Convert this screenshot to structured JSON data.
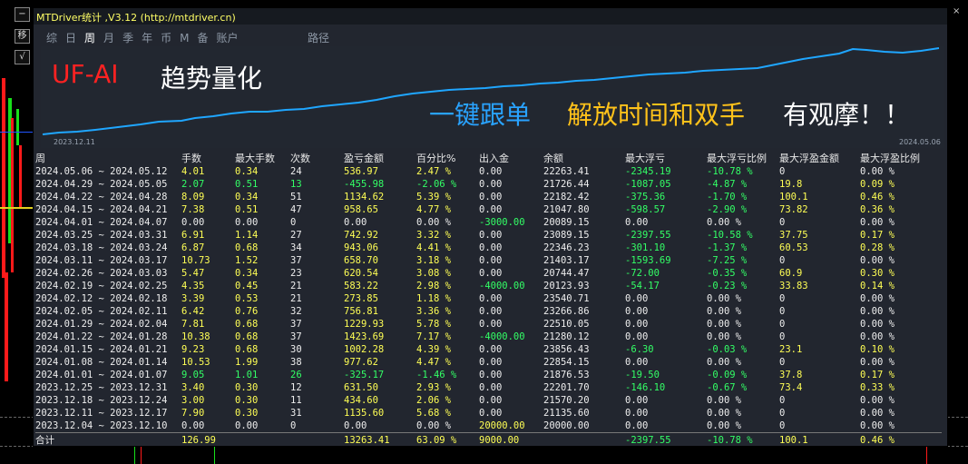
{
  "window": {
    "title": "MTDriver统计 ,V3.12 (http://mtdriver.cn)",
    "close_label": "×"
  },
  "side_buttons": [
    "−",
    "移",
    "√"
  ],
  "tabs": [
    "综",
    "日",
    "周",
    "月",
    "季",
    "年",
    "币",
    "M",
    "备",
    "账户"
  ],
  "active_tab": 2,
  "path_label": "路径",
  "banner": {
    "brand": "UF-AI",
    "slogan_1": "趋势量化",
    "slogan_2": "一键跟单",
    "slogan_3": "解放时间和双手",
    "slogan_4": "有观摩！！",
    "start_date": "2023.12.11",
    "end_date": "2024.05.06",
    "colors": {
      "brand": "#ff2222",
      "slogan_2": "#29a3ff",
      "slogan_3": "#ffc21a",
      "curve": "#1fa6ff"
    }
  },
  "table": {
    "headers": [
      "周",
      "手数",
      "最大手数",
      "次数",
      "盈亏金额",
      "百分比%",
      "出入金",
      "余额",
      "最大浮亏",
      "最大浮亏比例",
      "最大浮盈金额",
      "最大浮盈比例"
    ],
    "rows": [
      [
        "2024.05.06 ~ 2024.05.12",
        "4.01",
        "0.34",
        "24",
        "536.97",
        "2.47 %",
        "0.00",
        "22263.41",
        "-2345.19",
        "-10.78 %",
        "0",
        "0.00 %"
      ],
      [
        "2024.04.29 ~ 2024.05.05",
        "2.07",
        "0.51",
        "13",
        "-455.98",
        "-2.06 %",
        "0.00",
        "21726.44",
        "-1087.05",
        "-4.87 %",
        "19.8",
        "0.09 %"
      ],
      [
        "2024.04.22 ~ 2024.04.28",
        "8.09",
        "0.34",
        "51",
        "1134.62",
        "5.39 %",
        "0.00",
        "22182.42",
        "-375.36",
        "-1.70 %",
        "100.1",
        "0.46 %"
      ],
      [
        "2024.04.15 ~ 2024.04.21",
        "7.38",
        "0.51",
        "47",
        "958.65",
        "4.77 %",
        "0.00",
        "21047.80",
        "-598.57",
        "-2.90 %",
        "73.82",
        "0.36 %"
      ],
      [
        "2024.04.01 ~ 2024.04.07",
        "0.00",
        "0.00",
        "0",
        "0.00",
        "0.00 %",
        "-3000.00",
        "20089.15",
        "0.00",
        "0.00 %",
        "0",
        "0.00 %"
      ],
      [
        "2024.03.25 ~ 2024.03.31",
        "6.91",
        "1.14",
        "27",
        "742.92",
        "3.32 %",
        "0.00",
        "23089.15",
        "-2397.55",
        "-10.58 %",
        "37.75",
        "0.17 %"
      ],
      [
        "2024.03.18 ~ 2024.03.24",
        "6.87",
        "0.68",
        "34",
        "943.06",
        "4.41 %",
        "0.00",
        "22346.23",
        "-301.10",
        "-1.37 %",
        "60.53",
        "0.28 %"
      ],
      [
        "2024.03.11 ~ 2024.03.17",
        "10.73",
        "1.52",
        "37",
        "658.70",
        "3.18 %",
        "0.00",
        "21403.17",
        "-1593.69",
        "-7.25 %",
        "0",
        "0.00 %"
      ],
      [
        "2024.02.26 ~ 2024.03.03",
        "5.47",
        "0.34",
        "23",
        "620.54",
        "3.08 %",
        "0.00",
        "20744.47",
        "-72.00",
        "-0.35 %",
        "60.9",
        "0.30 %"
      ],
      [
        "2024.02.19 ~ 2024.02.25",
        "4.35",
        "0.45",
        "21",
        "583.22",
        "2.98 %",
        "-4000.00",
        "20123.93",
        "-54.17",
        "-0.23 %",
        "33.83",
        "0.14 %"
      ],
      [
        "2024.02.12 ~ 2024.02.18",
        "3.39",
        "0.53",
        "21",
        "273.85",
        "1.18 %",
        "0.00",
        "23540.71",
        "0.00",
        "0.00 %",
        "0",
        "0.00 %"
      ],
      [
        "2024.02.05 ~ 2024.02.11",
        "6.42",
        "0.76",
        "32",
        "756.81",
        "3.36 %",
        "0.00",
        "23266.86",
        "0.00",
        "0.00 %",
        "0",
        "0.00 %"
      ],
      [
        "2024.01.29 ~ 2024.02.04",
        "7.81",
        "0.68",
        "37",
        "1229.93",
        "5.78 %",
        "0.00",
        "22510.05",
        "0.00",
        "0.00 %",
        "0",
        "0.00 %"
      ],
      [
        "2024.01.22 ~ 2024.01.28",
        "10.38",
        "0.68",
        "37",
        "1423.69",
        "7.17 %",
        "-4000.00",
        "21280.12",
        "0.00",
        "0.00 %",
        "0",
        "0.00 %"
      ],
      [
        "2024.01.15 ~ 2024.01.21",
        "9.23",
        "0.68",
        "30",
        "1002.28",
        "4.39 %",
        "0.00",
        "23856.43",
        "-6.30",
        "-0.03 %",
        "23.1",
        "0.10 %"
      ],
      [
        "2024.01.08 ~ 2024.01.14",
        "10.53",
        "1.99",
        "38",
        "977.62",
        "4.47 %",
        "0.00",
        "22854.15",
        "0.00",
        "0.00 %",
        "0",
        "0.00 %"
      ],
      [
        "2024.01.01 ~ 2024.01.07",
        "9.05",
        "1.01",
        "26",
        "-325.17",
        "-1.46 %",
        "0.00",
        "21876.53",
        "-19.50",
        "-0.09 %",
        "37.8",
        "0.17 %"
      ],
      [
        "2023.12.25 ~ 2023.12.31",
        "3.40",
        "0.30",
        "12",
        "631.50",
        "2.93 %",
        "0.00",
        "22201.70",
        "-146.10",
        "-0.67 %",
        "73.4",
        "0.33 %"
      ],
      [
        "2023.12.18 ~ 2023.12.24",
        "3.00",
        "0.30",
        "11",
        "434.60",
        "2.06 %",
        "0.00",
        "21570.20",
        "0.00",
        "0.00 %",
        "0",
        "0.00 %"
      ],
      [
        "2023.12.11 ~ 2023.12.17",
        "7.90",
        "0.30",
        "31",
        "1135.60",
        "5.68 %",
        "0.00",
        "21135.60",
        "0.00",
        "0.00 %",
        "0",
        "0.00 %"
      ],
      [
        "2023.12.04 ~ 2023.12.10",
        "0.00",
        "0.00",
        "0",
        "0.00",
        "0.00 %",
        "20000.00",
        "20000.00",
        "0.00",
        "0.00 %",
        "0",
        "0.00 %"
      ]
    ],
    "total": [
      "合计",
      "126.99",
      "",
      "",
      "13263.41",
      "63.09 %",
      "9000.00",
      "",
      "-2397.55",
      "-10.78 %",
      "100.1",
      "0.46 %"
    ]
  }
}
